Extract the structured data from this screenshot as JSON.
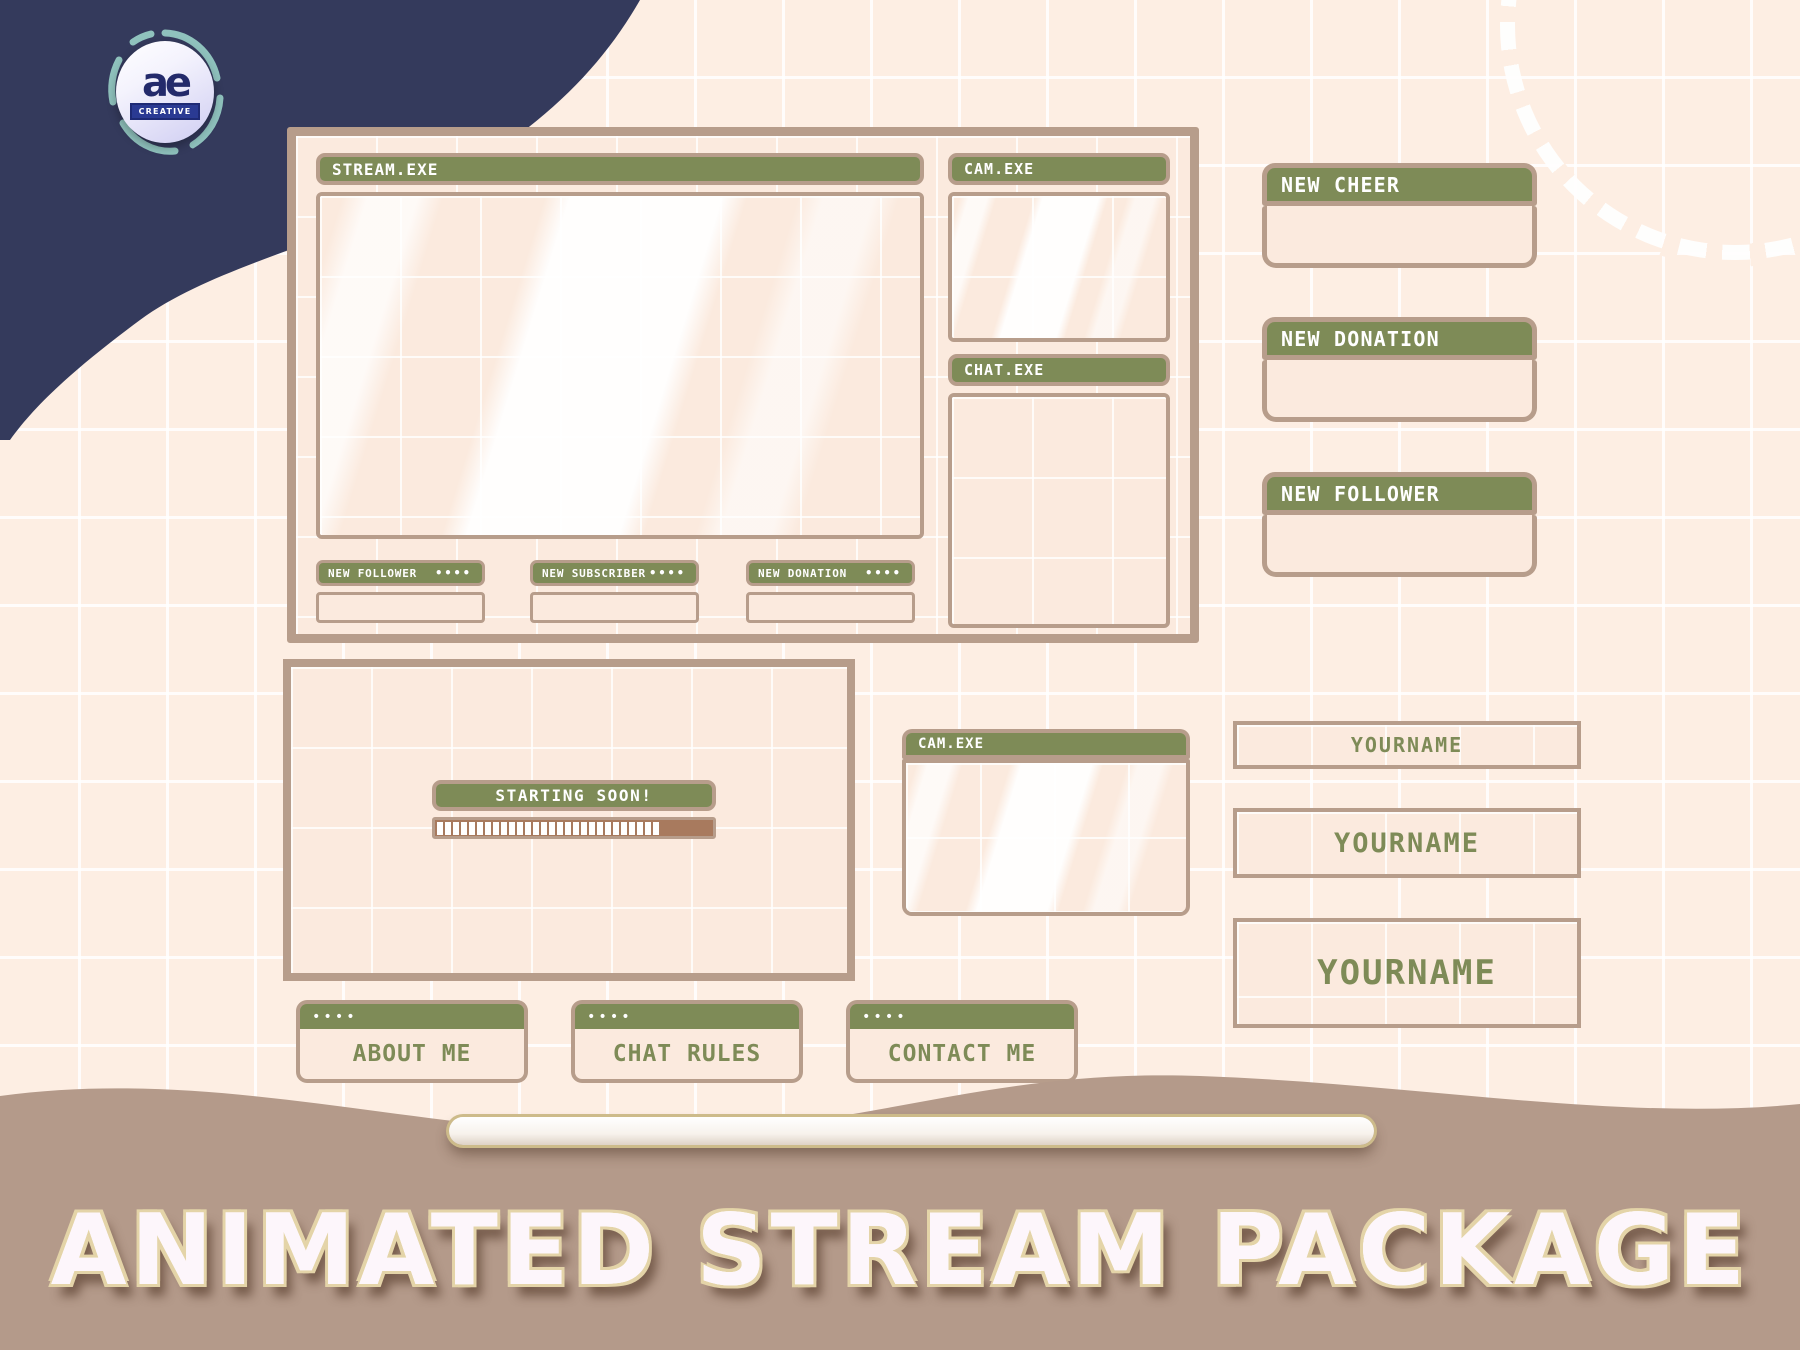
{
  "brand": {
    "logo_mark": "ae",
    "logo_tag": "CREATIVE"
  },
  "overlay": {
    "stream_window_title": "STREAM.EXE",
    "cam_window_title": "CAM.EXE",
    "chat_window_title": "CHAT.EXE",
    "alerts": [
      {
        "label": "NEW FOLLOWER",
        "dots": "••••"
      },
      {
        "label": "NEW SUBSCRIBER",
        "dots": "••••"
      },
      {
        "label": "NEW DONATION",
        "dots": "••••"
      }
    ]
  },
  "alert_boxes": [
    {
      "label": "NEW CHEER"
    },
    {
      "label": "NEW DONATION"
    },
    {
      "label": "NEW FOLLOWER"
    }
  ],
  "starting_soon": {
    "label": "STARTING SOON!",
    "progress_percent": 83,
    "segments_total": 34,
    "segments_filled": 28
  },
  "lower_cam": {
    "title": "CAM.EXE"
  },
  "panel_buttons": [
    {
      "dots": "••••",
      "label": "ABOUT ME"
    },
    {
      "dots": "••••",
      "label": "CHAT RULES"
    },
    {
      "dots": "••••",
      "label": "CONTACT ME"
    }
  ],
  "name_banners": [
    {
      "label": "YOURNAME"
    },
    {
      "label": "YOURNAME"
    },
    {
      "label": "YOURNAME"
    }
  ],
  "footer": {
    "title": "ANIMATED STREAM PACKAGE"
  },
  "colors": {
    "background": "#fdeee3",
    "grid_line": "#ffffff",
    "accent_green": "#7e8b57",
    "frame_brown": "#b79d8b",
    "panel_cream": "#fbeade",
    "navy": "#343a5c",
    "wave_brown": "#b49a8a",
    "progress_fill": "#ffffff",
    "progress_track": "#a87a5e",
    "logo_blue": "#2a3a93"
  }
}
